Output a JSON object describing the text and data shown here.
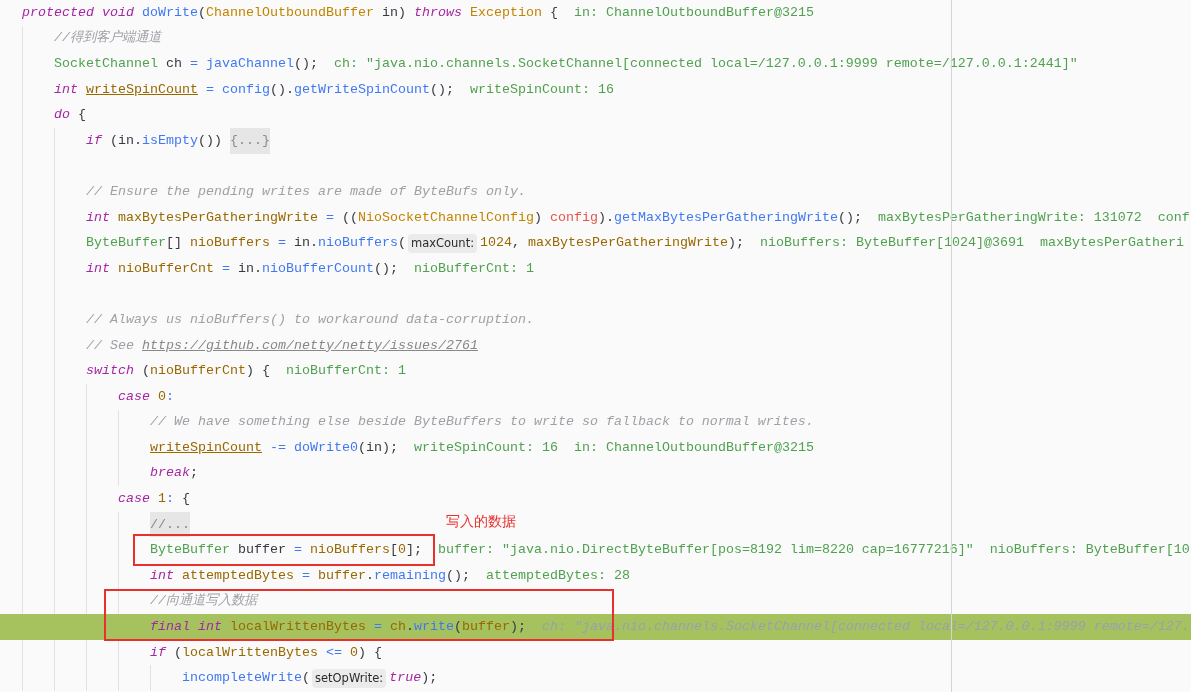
{
  "editor": {
    "lines": [
      {
        "kind": "code",
        "tokens": [
          {
            "kind": "kw",
            "text": "protected void "
          },
          {
            "kind": "fn",
            "text": "doWrite"
          },
          {
            "kind": "p",
            "text": "("
          },
          {
            "kind": "cls",
            "text": "ChannelOutboundBuffer"
          },
          {
            "kind": "p",
            "text": " in) "
          },
          {
            "kind": "kw",
            "text": "throws "
          },
          {
            "kind": "cls",
            "text": "Exception"
          },
          {
            "kind": "p",
            "text": " {"
          },
          {
            "kind": "dbg",
            "text": "in: ChannelOutboundBuffer@3215"
          }
        ],
        "children": [
          {
            "kind": "code",
            "tokens": [
              {
                "kind": "cm",
                "text": "//得到客户端通道"
              }
            ]
          },
          {
            "kind": "code",
            "tokens": [
              {
                "kind": "typ",
                "text": "SocketChannel"
              },
              {
                "kind": "p",
                "text": " ch "
              },
              {
                "kind": "op",
                "text": "= "
              },
              {
                "kind": "fn",
                "text": "javaChannel"
              },
              {
                "kind": "p",
                "text": "();"
              },
              {
                "kind": "dbg",
                "text": "ch: \"java.nio.channels.SocketChannel[connected local=/127.0.0.1:9999 remote=/127.0.0.1:2441]\""
              }
            ]
          },
          {
            "kind": "code",
            "tokens": [
              {
                "kind": "kw",
                "text": "int "
              },
              {
                "kind": "varu",
                "text": "writeSpinCount"
              },
              {
                "kind": "op",
                "text": " = "
              },
              {
                "kind": "fn",
                "text": "config"
              },
              {
                "kind": "p",
                "text": "()."
              },
              {
                "kind": "fn",
                "text": "getWriteSpinCount"
              },
              {
                "kind": "p",
                "text": "();"
              },
              {
                "kind": "dbg",
                "text": "writeSpinCount: 16"
              }
            ]
          },
          {
            "kind": "code",
            "tokens": [
              {
                "kind": "kw",
                "text": "do "
              },
              {
                "kind": "p",
                "text": "{"
              }
            ],
            "children": [
              {
                "kind": "code",
                "tokens": [
                  {
                    "kind": "kw",
                    "text": "if "
                  },
                  {
                    "kind": "p",
                    "text": "(in."
                  },
                  {
                    "kind": "fn",
                    "text": "isEmpty"
                  },
                  {
                    "kind": "p",
                    "text": "()) "
                  },
                  {
                    "kind": "fold",
                    "text": "{...}"
                  }
                ]
              },
              {
                "kind": "blank"
              },
              {
                "kind": "code",
                "tokens": [
                  {
                    "kind": "cm",
                    "text": "// Ensure the pending writes are made of ByteBufs only."
                  }
                ]
              },
              {
                "kind": "code",
                "tokens": [
                  {
                    "kind": "kw",
                    "text": "int "
                  },
                  {
                    "kind": "var",
                    "text": "maxBytesPerGatheringWrite"
                  },
                  {
                    "kind": "op",
                    "text": " = "
                  },
                  {
                    "kind": "p",
                    "text": "(("
                  },
                  {
                    "kind": "cls",
                    "text": "NioSocketChannelConfig"
                  },
                  {
                    "kind": "p",
                    "text": ") "
                  },
                  {
                    "kind": "fld",
                    "text": "config"
                  },
                  {
                    "kind": "p",
                    "text": ")."
                  },
                  {
                    "kind": "fn",
                    "text": "getMaxBytesPerGatheringWrite"
                  },
                  {
                    "kind": "p",
                    "text": "();"
                  },
                  {
                    "kind": "dbg",
                    "text": "maxBytesPerGatheringWrite: 131072"
                  },
                  {
                    "kind": "dbg",
                    "text": "conf"
                  }
                ]
              },
              {
                "kind": "code",
                "tokens": [
                  {
                    "kind": "typ",
                    "text": "ByteBuffer"
                  },
                  {
                    "kind": "p",
                    "text": "[] "
                  },
                  {
                    "kind": "var",
                    "text": "nioBuffers"
                  },
                  {
                    "kind": "op",
                    "text": " = "
                  },
                  {
                    "kind": "p",
                    "text": "in."
                  },
                  {
                    "kind": "fn",
                    "text": "nioBuffers"
                  },
                  {
                    "kind": "p",
                    "text": "("
                  },
                  {
                    "kind": "hint",
                    "text": "maxCount:"
                  },
                  {
                    "kind": "num",
                    "text": "1024"
                  },
                  {
                    "kind": "p",
                    "text": ", "
                  },
                  {
                    "kind": "var",
                    "text": "maxBytesPerGatheringWrite"
                  },
                  {
                    "kind": "p",
                    "text": ");"
                  },
                  {
                    "kind": "dbg",
                    "text": "nioBuffers: ByteBuffer[1024]@3691"
                  },
                  {
                    "kind": "dbg",
                    "text": "maxBytesPerGatheri"
                  }
                ]
              },
              {
                "kind": "code",
                "tokens": [
                  {
                    "kind": "kw",
                    "text": "int "
                  },
                  {
                    "kind": "var",
                    "text": "nioBufferCnt"
                  },
                  {
                    "kind": "op",
                    "text": " = "
                  },
                  {
                    "kind": "p",
                    "text": "in."
                  },
                  {
                    "kind": "fn",
                    "text": "nioBufferCount"
                  },
                  {
                    "kind": "p",
                    "text": "();"
                  },
                  {
                    "kind": "dbg",
                    "text": "nioBufferCnt: 1"
                  }
                ]
              },
              {
                "kind": "blank"
              },
              {
                "kind": "code",
                "tokens": [
                  {
                    "kind": "cm",
                    "text": "// Always us nioBuffers() to workaround data-corruption."
                  }
                ]
              },
              {
                "kind": "code",
                "tokens": [
                  {
                    "kind": "cm",
                    "text": "// See "
                  },
                  {
                    "kind": "link",
                    "text": "https://github.com/netty/netty/issues/2761"
                  }
                ]
              },
              {
                "kind": "code",
                "tokens": [
                  {
                    "kind": "kw",
                    "text": "switch "
                  },
                  {
                    "kind": "p",
                    "text": "("
                  },
                  {
                    "kind": "var",
                    "text": "nioBufferCnt"
                  },
                  {
                    "kind": "p",
                    "text": ") {"
                  },
                  {
                    "kind": "dbg",
                    "text": "nioBufferCnt: 1"
                  }
                ],
                "children": [
                  {
                    "kind": "code",
                    "tokens": [
                      {
                        "kind": "kw",
                        "text": "case "
                      },
                      {
                        "kind": "num",
                        "text": "0"
                      },
                      {
                        "kind": "op",
                        "text": ":"
                      }
                    ],
                    "children": [
                      {
                        "kind": "code",
                        "tokens": [
                          {
                            "kind": "cm",
                            "text": "// We have something else beside ByteBuffers to write so fallback to normal writes."
                          }
                        ]
                      },
                      {
                        "kind": "code",
                        "tokens": [
                          {
                            "kind": "varu",
                            "text": "writeSpinCount"
                          },
                          {
                            "kind": "op",
                            "text": " -= "
                          },
                          {
                            "kind": "fn",
                            "text": "doWrite0"
                          },
                          {
                            "kind": "p",
                            "text": "(in);"
                          },
                          {
                            "kind": "dbg",
                            "text": "writeSpinCount: 16"
                          },
                          {
                            "kind": "dbg",
                            "text": "in: ChannelOutboundBuffer@3215"
                          }
                        ]
                      },
                      {
                        "kind": "code",
                        "tokens": [
                          {
                            "kind": "kw",
                            "text": "break"
                          },
                          {
                            "kind": "p",
                            "text": ";"
                          }
                        ]
                      }
                    ]
                  },
                  {
                    "kind": "code",
                    "tokens": [
                      {
                        "kind": "kw",
                        "text": "case "
                      },
                      {
                        "kind": "num",
                        "text": "1"
                      },
                      {
                        "kind": "op",
                        "text": ":"
                      },
                      {
                        "kind": "p",
                        "text": " {"
                      }
                    ],
                    "children": [
                      {
                        "kind": "code",
                        "tokens": [
                          {
                            "kind": "fold",
                            "text": "//..."
                          }
                        ]
                      },
                      {
                        "kind": "code",
                        "tokens": [
                          {
                            "kind": "typ",
                            "text": "ByteBuffer"
                          },
                          {
                            "kind": "p",
                            "text": " buffer "
                          },
                          {
                            "kind": "op",
                            "text": "= "
                          },
                          {
                            "kind": "var",
                            "text": "nioBuffers"
                          },
                          {
                            "kind": "p",
                            "text": "["
                          },
                          {
                            "kind": "num",
                            "text": "0"
                          },
                          {
                            "kind": "p",
                            "text": "];"
                          },
                          {
                            "kind": "dbg",
                            "text": "buffer: \"java.nio.DirectByteBuffer[pos=8192 lim=8220 cap=16777216]\""
                          },
                          {
                            "kind": "dbg",
                            "text": "nioBuffers: ByteBuffer[10"
                          }
                        ]
                      },
                      {
                        "kind": "code",
                        "tokens": [
                          {
                            "kind": "kw",
                            "text": "int "
                          },
                          {
                            "kind": "var",
                            "text": "attemptedBytes"
                          },
                          {
                            "kind": "op",
                            "text": " = "
                          },
                          {
                            "kind": "var",
                            "text": "buffer"
                          },
                          {
                            "kind": "p",
                            "text": "."
                          },
                          {
                            "kind": "fn",
                            "text": "remaining"
                          },
                          {
                            "kind": "p",
                            "text": "();"
                          },
                          {
                            "kind": "dbg",
                            "text": "attemptedBytes: 28"
                          }
                        ]
                      },
                      {
                        "kind": "code",
                        "tokens": [
                          {
                            "kind": "cm",
                            "text": "//向通道写入数据"
                          }
                        ]
                      },
                      {
                        "kind": "code",
                        "current": true,
                        "tokens": [
                          {
                            "kind": "kw",
                            "text": "final int "
                          },
                          {
                            "kind": "var",
                            "text": "localWrittenBytes"
                          },
                          {
                            "kind": "op",
                            "text": " = "
                          },
                          {
                            "kind": "var",
                            "text": "ch"
                          },
                          {
                            "kind": "p",
                            "text": "."
                          },
                          {
                            "kind": "fn",
                            "text": "write"
                          },
                          {
                            "kind": "p",
                            "text": "("
                          },
                          {
                            "kind": "var",
                            "text": "buffer"
                          },
                          {
                            "kind": "p",
                            "text": ");"
                          },
                          {
                            "kind": "dbgdim",
                            "text": "ch: \"java.nio.channels.SocketChannel[connected local=/127.0.0.1:9999 remote=/127."
                          }
                        ]
                      },
                      {
                        "kind": "code",
                        "tokens": [
                          {
                            "kind": "kw",
                            "text": "if "
                          },
                          {
                            "kind": "p",
                            "text": "("
                          },
                          {
                            "kind": "var",
                            "text": "localWrittenBytes"
                          },
                          {
                            "kind": "op",
                            "text": " <= "
                          },
                          {
                            "kind": "num",
                            "text": "0"
                          },
                          {
                            "kind": "p",
                            "text": ") {"
                          }
                        ],
                        "children": [
                          {
                            "kind": "code",
                            "tokens": [
                              {
                                "kind": "fn",
                                "text": "incompleteWrite"
                              },
                              {
                                "kind": "p",
                                "text": "("
                              },
                              {
                                "kind": "hint",
                                "text": "setOpWrite:"
                              },
                              {
                                "kind": "kw",
                                "text": "true"
                              },
                              {
                                "kind": "p",
                                "text": ");"
                              }
                            ]
                          }
                        ]
                      }
                    ]
                  }
                ]
              }
            ]
          }
        ]
      }
    ]
  },
  "annotation": {
    "text": "写入的数据"
  }
}
